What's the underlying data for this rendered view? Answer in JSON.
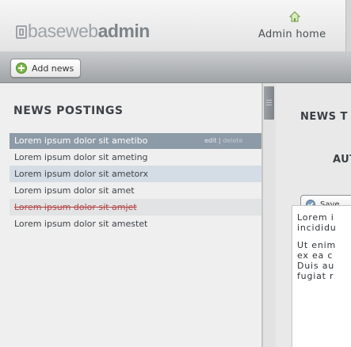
{
  "header": {
    "logo_light": "baseweb",
    "logo_bold": "admin",
    "home_label": "Admin home"
  },
  "toolbar": {
    "add_news_label": "Add news"
  },
  "news": {
    "title": "NEWS POSTINGS",
    "edit_label": "edit",
    "separator": "|",
    "delete_label": "delete",
    "items": [
      {
        "title": "Lorem ipsum dolor sit ametibo",
        "state": "selected"
      },
      {
        "title": "Lorem ipsum dolor sit ameting",
        "state": "normal"
      },
      {
        "title": "Lorem ipsum dolor sit ametorx",
        "state": "alt"
      },
      {
        "title": "Lorem ipsum dolor sit amet",
        "state": "normal"
      },
      {
        "title": "Lorem ipsum dolor sit amjet",
        "state": "deleted"
      },
      {
        "title": "Lorem ipsum dolor sit amestet",
        "state": "normal"
      }
    ]
  },
  "editor": {
    "title": "NEWS T",
    "author_label": "AUT",
    "save_label": "Save",
    "body_lines": [
      [
        "Lorem i",
        "incididu"
      ],
      [
        "Ut enim",
        "ex ea c",
        "Duis au",
        "fugiat r"
      ]
    ]
  },
  "colors": {
    "selected_row": "#8d9aa7",
    "tinted_row": "#d4dde5",
    "deleted_text": "#b34444",
    "toolbar": "#b4b7ba"
  }
}
